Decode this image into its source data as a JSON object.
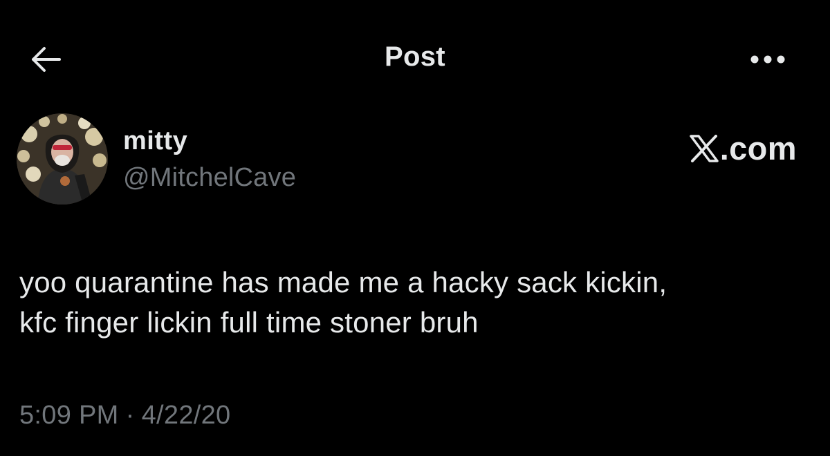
{
  "header": {
    "title": "Post"
  },
  "author": {
    "display_name": "mitty",
    "handle": "@MitchelCave"
  },
  "brand": {
    "text": ".com"
  },
  "post": {
    "lines": [
      "yoo quarantine has made me a hacky sack kickin,",
      "kfc finger lickin full time stoner bruh"
    ]
  },
  "meta": {
    "time": "5:09 PM",
    "separator": "·",
    "date": "4/22/20"
  },
  "icons": {
    "back": "arrow-left-icon",
    "more": "more-dots-icon",
    "brand": "x-logo-icon"
  },
  "colors": {
    "background": "#000000",
    "primary_text": "#e7e9ea",
    "secondary_text": "#71767b"
  }
}
